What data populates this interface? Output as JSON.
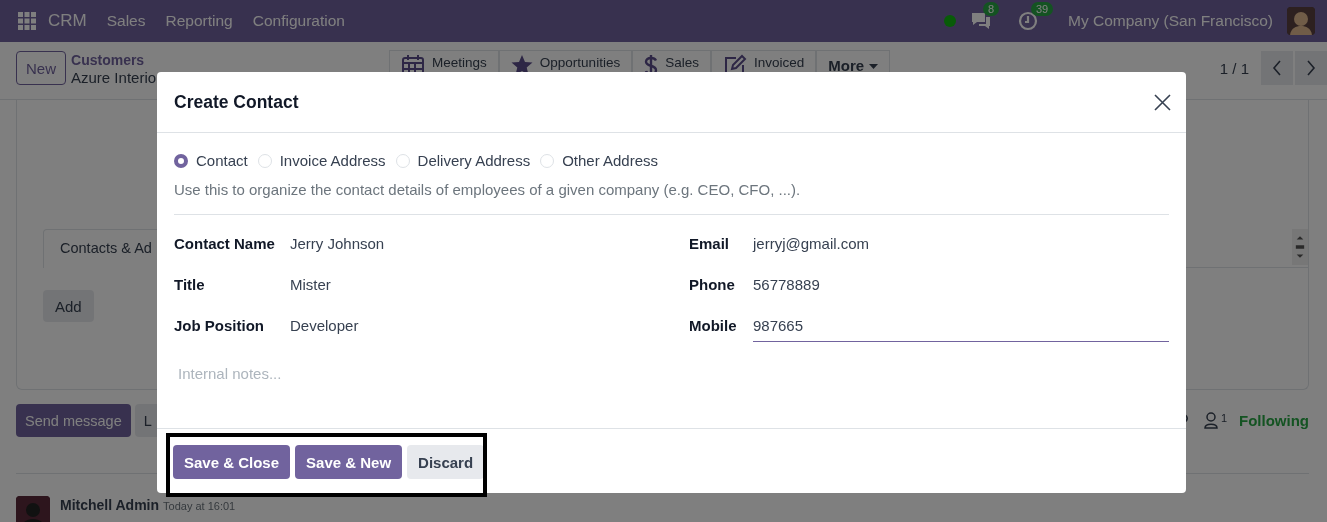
{
  "navbar": {
    "app_name": "CRM",
    "menus": [
      "Sales",
      "Reporting",
      "Configuration"
    ],
    "messages_count": "8",
    "activities_count": "39",
    "company": "My Company (San Francisco)"
  },
  "control_panel": {
    "new_button": "New",
    "breadcrumb_parent": "Customers",
    "breadcrumb_current": "Azure Interio",
    "smart_buttons": [
      {
        "kind": "calendar",
        "label": "Meetings"
      },
      {
        "kind": "star",
        "label": "Opportunities"
      },
      {
        "kind": "dollar",
        "label": "Sales"
      },
      {
        "kind": "invoice",
        "label": "Invoiced"
      }
    ],
    "more_button": "More",
    "pager": "1 / 1"
  },
  "form": {
    "tabs": [
      "Contacts & Ad"
    ],
    "add_button": "Add"
  },
  "chatter": {
    "send_message": "Send message",
    "log_note": "L",
    "followers_count": "1",
    "follow_status": "Following",
    "messages": [
      {
        "author": "Mitchell Admin",
        "time": "Today at 16:01"
      }
    ]
  },
  "dialog": {
    "title": "Create Contact",
    "address_types": [
      {
        "label": "Contact",
        "selected": true
      },
      {
        "label": "Invoice Address",
        "selected": false
      },
      {
        "label": "Delivery Address",
        "selected": false
      },
      {
        "label": "Other Address",
        "selected": false
      }
    ],
    "description": "Use this to organize the contact details of employees of a given company (e.g. CEO, CFO, ...).",
    "left_fields": [
      {
        "label": "Contact Name",
        "value": "Jerry Johnson",
        "focused": false
      },
      {
        "label": "Title",
        "value": "Mister",
        "focused": false
      },
      {
        "label": "Job Position",
        "value": "Developer",
        "focused": false
      }
    ],
    "right_fields": [
      {
        "label": "Email",
        "value": "jerryj@gmail.com",
        "focused": false
      },
      {
        "label": "Phone",
        "value": "56778889",
        "focused": false
      },
      {
        "label": "Mobile",
        "value": "987665",
        "focused": true
      }
    ],
    "notes": {
      "placeholder": "Internal notes..."
    },
    "buttons": [
      {
        "label": "Save & Close",
        "kind": "primary"
      },
      {
        "label": "Save & New",
        "kind": "primary"
      },
      {
        "label": "Discard",
        "kind": "secondary"
      }
    ],
    "buttons_highlighted": true
  }
}
